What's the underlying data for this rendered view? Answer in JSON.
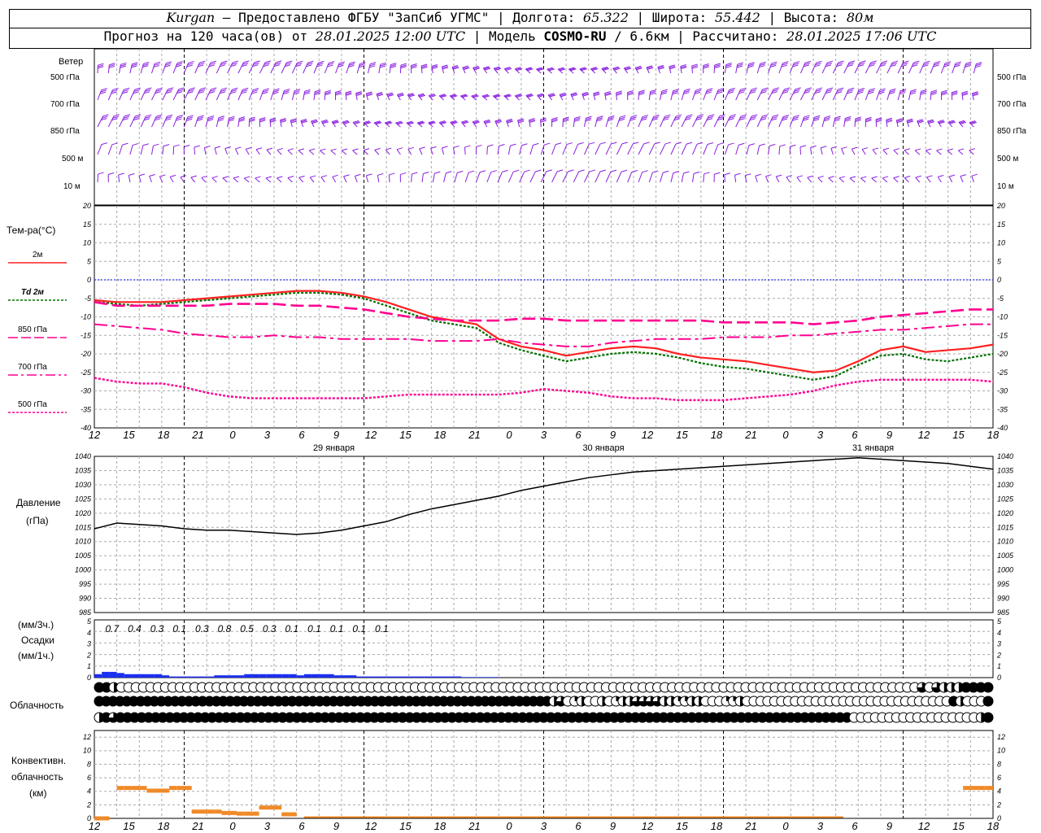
{
  "header": {
    "station": "Kurgan",
    "source": " — Предоставлено ФГБУ \"ЗапСиб УГМС\" | Долгота: ",
    "lon": "65.322",
    "lat_label": " | Широта: ",
    "lat": "55.442",
    "alt_label": " | Высота: ",
    "alt": "80м",
    "forecast_label": "Прогноз на 120 часа(ов) от ",
    "forecast_time": "28.01.2025 12:00 UTC",
    "model_label": " | Модель ",
    "model": "COSMO-RU",
    "resolution": " / 6.6км",
    "calc_label": " | Рассчитано: ",
    "calc_time": "28.01.2025 17:06 UTC"
  },
  "time_axis": {
    "hour_labels": [
      "12",
      "15",
      "18",
      "21",
      "0",
      "3",
      "6",
      "9",
      "12",
      "15",
      "18",
      "21",
      "0",
      "3",
      "6",
      "9",
      "12",
      "15",
      "18",
      "21",
      "0",
      "3",
      "6",
      "9",
      "12",
      "15",
      "18"
    ],
    "day_labels": [
      "29 января",
      "30 января",
      "31 января"
    ]
  },
  "panels": {
    "wind": {
      "title": "Ветер",
      "levels": [
        "500 гПа",
        "700 гПа",
        "850 гПа",
        "500 м",
        "10 м"
      ]
    },
    "temp": {
      "title": "Тем-ра(°C)",
      "legend": [
        "2м",
        "Td  2м",
        "850 гПа",
        "700 гПа",
        "500 гПа"
      ],
      "ticks": [
        "20",
        "15",
        "10",
        "5",
        "0",
        "-5",
        "-10",
        "-15",
        "-20",
        "-25",
        "-30",
        "-35",
        "-40"
      ]
    },
    "pressure": {
      "title1": "Давление",
      "title2": "(гПа)",
      "ticks": [
        "1040",
        "1035",
        "1030",
        "1025",
        "1020",
        "1015",
        "1010",
        "1005",
        "1000",
        "995",
        "990",
        "985"
      ]
    },
    "precip": {
      "title1": "(мм/3ч.)",
      "title2": "Осадки",
      "title3": "(мм/1ч.)",
      "ticks": [
        "5",
        "4",
        "3",
        "2",
        "1",
        "0"
      ],
      "amounts": [
        "0.7",
        "0.4",
        "0.3",
        "0.1",
        "0.3",
        "0.8",
        "0.5",
        "0.3",
        "0.1",
        "0.1",
        "0.1",
        "0.1",
        "0.1"
      ]
    },
    "cloud": {
      "title": "Облачность"
    },
    "conv": {
      "title1": "Конвективн.",
      "title2": "облачность",
      "title3": "(км)",
      "ticks": [
        "12",
        "10",
        "8",
        "6",
        "4",
        "2",
        "0"
      ]
    }
  },
  "colors": {
    "t2m": "#ff2020",
    "td": "#007000",
    "p850": "#ff0090",
    "p700": "#ff0090",
    "p500": "#ff0090",
    "wind": "#8a1ee0",
    "pressure": "#000000",
    "precip": "#1a2ff0",
    "conv": "#f08a28",
    "zero": "#0000ff"
  },
  "chart_data": [
    {
      "type": "line",
      "title": "Тем-ра(°C)",
      "x_hours": [
        0,
        3,
        6,
        9,
        12,
        15,
        18,
        21,
        24,
        27,
        30,
        33,
        36,
        39,
        42,
        45,
        48,
        51,
        54,
        57,
        60,
        63,
        66,
        69,
        72,
        75,
        78,
        81,
        84,
        87,
        90,
        93,
        96,
        99,
        102,
        105,
        108,
        111,
        114,
        117,
        120
      ],
      "ylim": [
        -40,
        20
      ],
      "series": [
        {
          "name": "2м",
          "values": [
            -5.5,
            -6,
            -6,
            -6,
            -5.5,
            -5,
            -4.5,
            -4,
            -3.5,
            -3,
            -3,
            -3.5,
            -4.5,
            -6,
            -8,
            -10,
            -11,
            -12,
            -16,
            -18,
            -19,
            -20.5,
            -19.5,
            -18.5,
            -18,
            -18.5,
            -20,
            -21,
            -21.5,
            -22,
            -23,
            -24,
            -25,
            -24.5,
            -22,
            -19,
            -18,
            -19.5,
            -19,
            -18.5,
            -17.5
          ]
        },
        {
          "name": "Td  2м",
          "values": [
            -6,
            -6.5,
            -7,
            -6.5,
            -6,
            -5.5,
            -5,
            -4.5,
            -4,
            -3.5,
            -3.5,
            -4,
            -5,
            -7,
            -9,
            -11,
            -12,
            -13,
            -17,
            -19,
            -20.5,
            -22,
            -21,
            -20,
            -19.5,
            -20,
            -21,
            -22.5,
            -23.5,
            -24,
            -25,
            -26,
            -27,
            -26,
            -23,
            -20.5,
            -20,
            -21.5,
            -22,
            -21,
            -20
          ]
        },
        {
          "name": "850 гПа",
          "values": [
            -6,
            -7,
            -7,
            -7,
            -7,
            -7,
            -6.5,
            -6.5,
            -6.5,
            -7,
            -7,
            -7.5,
            -8,
            -9,
            -10,
            -10.5,
            -11,
            -11,
            -11,
            -10.5,
            -10.5,
            -11,
            -11,
            -11,
            -11,
            -11,
            -11,
            -11,
            -11.5,
            -11.5,
            -11.5,
            -11.5,
            -12,
            -11.5,
            -11,
            -10,
            -9.5,
            -9,
            -8.5,
            -8,
            -8
          ]
        },
        {
          "name": "700 гПа",
          "values": [
            -12,
            -12.5,
            -13,
            -13.5,
            -14.5,
            -15,
            -15.5,
            -15.5,
            -15,
            -15.5,
            -15.5,
            -16,
            -16,
            -16,
            -16,
            -16.5,
            -16.5,
            -16.5,
            -16,
            -17,
            -17.5,
            -18,
            -18,
            -17,
            -16.5,
            -16,
            -16,
            -16,
            -15.5,
            -15.5,
            -15.5,
            -15,
            -15,
            -14.5,
            -14,
            -13.5,
            -13.5,
            -13,
            -12.5,
            -12,
            -12
          ]
        },
        {
          "name": "500 гПа",
          "values": [
            -26.5,
            -27.5,
            -28,
            -28,
            -29,
            -30.5,
            -31.5,
            -32,
            -32,
            -32,
            -32,
            -32,
            -32,
            -31.5,
            -31,
            -31,
            -31,
            -31,
            -31,
            -30.5,
            -29.5,
            -30,
            -30.5,
            -31.5,
            -32,
            -32,
            -32.5,
            -32.5,
            -32.5,
            -32,
            -31.5,
            -31,
            -30,
            -28.5,
            -27.5,
            -27,
            -27,
            -27,
            -27,
            -27,
            -27.5
          ]
        }
      ]
    },
    {
      "type": "line",
      "title": "Давление",
      "x_hours": [
        0,
        3,
        6,
        9,
        12,
        15,
        18,
        21,
        24,
        27,
        30,
        33,
        36,
        39,
        42,
        45,
        48,
        51,
        54,
        57,
        60,
        63,
        66,
        69,
        72,
        75,
        78,
        81,
        84,
        87,
        90,
        93,
        96,
        99,
        102,
        105,
        108,
        111,
        114,
        117,
        120
      ],
      "ylim": [
        985,
        1040
      ],
      "series": [
        {
          "name": "Давление",
          "values": [
            1014.5,
            1016.5,
            1016,
            1015.5,
            1014.5,
            1014,
            1014,
            1013.5,
            1013,
            1012.5,
            1013,
            1014,
            1015.5,
            1017,
            1019.5,
            1021.5,
            1023,
            1024.5,
            1026,
            1028,
            1029.5,
            1031,
            1032.5,
            1033.5,
            1034.5,
            1035,
            1035.5,
            1036,
            1036.5,
            1037,
            1037.5,
            1038,
            1038.5,
            1039,
            1039.5,
            1039,
            1038.5,
            1038,
            1037.5,
            1036.5,
            1035.5
          ]
        }
      ]
    },
    {
      "type": "bar",
      "title": "Осадки",
      "x_hours_hourly": [
        1,
        2,
        3,
        4,
        5,
        6,
        7,
        8,
        9,
        10,
        11,
        12,
        13,
        14,
        15,
        16,
        17,
        18,
        19,
        20,
        21,
        22,
        23,
        24,
        25,
        26,
        27,
        28,
        29,
        30,
        31,
        32,
        33,
        34,
        35,
        36,
        37,
        38,
        39,
        40,
        41,
        42,
        43,
        44,
        45,
        46,
        47,
        48,
        49,
        50,
        51,
        52,
        53,
        54
      ],
      "ylim": [
        0,
        5
      ],
      "values": [
        0.3,
        0.5,
        0.5,
        0.4,
        0.3,
        0.3,
        0.3,
        0.3,
        0.3,
        0.2,
        0.1,
        0.1,
        0.1,
        0.1,
        0.1,
        0.1,
        0.2,
        0.2,
        0.2,
        0.2,
        0.3,
        0.3,
        0.3,
        0.3,
        0.3,
        0.3,
        0.3,
        0.2,
        0.3,
        0.3,
        0.3,
        0.3,
        0.2,
        0.2,
        0.2,
        0.1,
        0.1,
        0.1,
        0.1,
        0.1,
        0.1,
        0.1,
        0.1,
        0.1,
        0.1,
        0.1,
        0.1,
        0.1,
        0.1,
        0.05,
        0.05,
        0.05,
        0.05,
        0.05
      ]
    },
    {
      "type": "bar",
      "title": "Конвективн. облачность",
      "x_hours_hourly": [
        1,
        2,
        3,
        4,
        5,
        6,
        7,
        8,
        9,
        10,
        11,
        12,
        13,
        14,
        15,
        16,
        17,
        18,
        19,
        20,
        21,
        22,
        23,
        24,
        25,
        26,
        27,
        117,
        118,
        119,
        120
      ],
      "ylim": [
        0,
        13
      ],
      "values": [
        0.3,
        0.3,
        0,
        4.8,
        4.8,
        4.8,
        4.8,
        4.4,
        4.4,
        4.4,
        4.8,
        4.8,
        4.8,
        1.3,
        1.3,
        1.3,
        1.3,
        1.1,
        1.1,
        1,
        1,
        1,
        1.9,
        1.9,
        1.9,
        0.9,
        0.9,
        4.8,
        4.8,
        4.8,
        4.8
      ]
    }
  ],
  "cloud_rows": {
    "low": "BBHOOOOOOOOOOOOOOOOOOOOOOOOOOOOOOOOOOOOOOOOOOOOOOOOOOOOOOOOOOOOOOOOOOOOOOOOOOOOOOOOOOOOOOOOOOOOOOOOOOOOOOOOOOOOOTOTHHHBBBB",
    "mid": "BBBBBBBBBBBBBBBBBBBBBBBBBBBBBBBBBBBBBBBBBBBBBBBBBBBBBBBBBBBBBBBBBBHTOQHOOHOQHHTTTTHHQQHHOOOQQHOOOOOOOOOOOOOOOOOOOOOOOOOOOOOOBHOOOB",
    "high": "HBTBBBBBBBBBBBBBBBBBBBBBBBBBBBBBBBBBBBBBBBBBBBBBBBBBBBBBBBBBBBBBBBBBBBBBBBBBBBBBBBBBBBBBBBBBBBBBBBBBBBBBBBBOOOOOOOOOOOOOOOOOOHB"
  }
}
